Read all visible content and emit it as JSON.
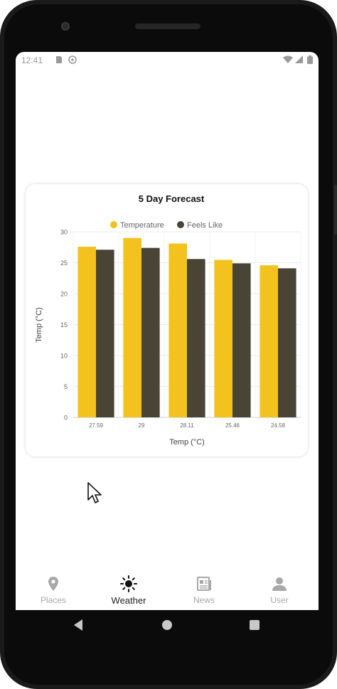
{
  "status_bar": {
    "time": "12:41"
  },
  "chart_data": {
    "type": "bar",
    "title": "5 Day Forecast",
    "categories": [
      "27.59",
      "29",
      "28.11",
      "25.46",
      "24.58"
    ],
    "series": [
      {
        "name": "Temperature",
        "color": "#f4c21f",
        "values": [
          27.59,
          29,
          28.11,
          25.46,
          24.58
        ]
      },
      {
        "name": "Feels Like",
        "color": "#4a4437",
        "values": [
          27.1,
          27.4,
          25.6,
          24.9,
          24.1
        ]
      }
    ],
    "xlabel": "Temp (°C)",
    "ylabel": "Temp (°C)",
    "ylim": [
      0,
      30
    ],
    "yticks": [
      0,
      5,
      10,
      15,
      20,
      25,
      30
    ],
    "legend": "top-center",
    "grid": true
  },
  "bottom_nav": {
    "items": [
      {
        "label": "Places",
        "icon": "place-icon",
        "active": false
      },
      {
        "label": "Weather",
        "icon": "sun-icon",
        "active": true
      },
      {
        "label": "News",
        "icon": "news-icon",
        "active": false
      },
      {
        "label": "User",
        "icon": "user-icon",
        "active": false
      }
    ]
  },
  "colors": {
    "accent": "#f4c21f",
    "secondary": "#4a4437",
    "inactive": "#a8a8a8"
  }
}
